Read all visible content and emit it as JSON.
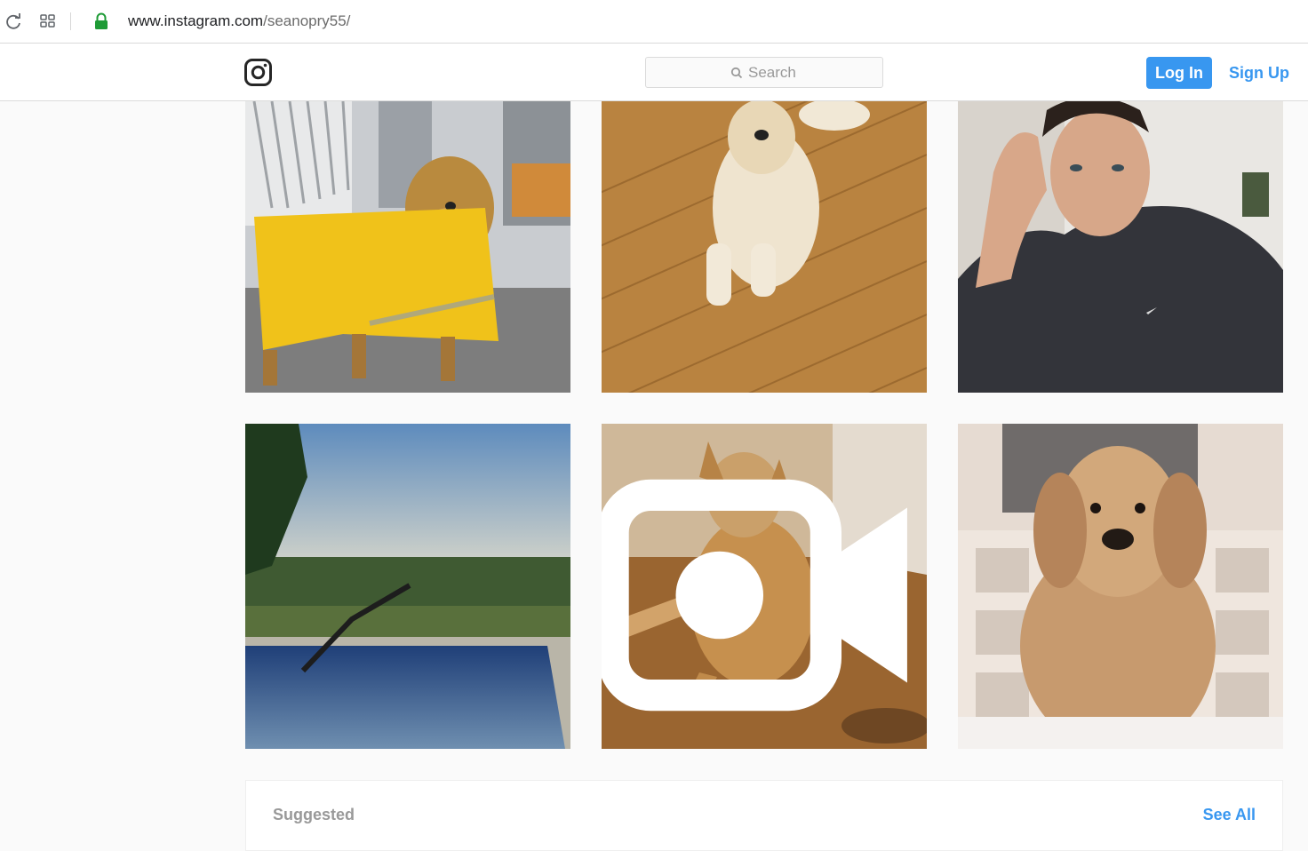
{
  "browser": {
    "url_host": "www.instagram.com",
    "url_path": "/seanopry55/"
  },
  "nav": {
    "search_placeholder": "Search",
    "login_label": "Log In",
    "signup_label": "Sign Up"
  },
  "photos": [
    {
      "subject": "golden retriever in yellow raincoat"
    },
    {
      "subject": "golden retriever on wood floor"
    },
    {
      "subject": "man in black hoodie selfie"
    },
    {
      "subject": "person diving into infinity pool"
    },
    {
      "subject": "golden retriever dancing",
      "is_video": true
    },
    {
      "subject": "golden retriever portrait"
    }
  ],
  "suggested": {
    "title": "Suggested",
    "see_all": "See All"
  },
  "colors": {
    "accent": "#3897f0",
    "lock_green": "#1e9b36"
  }
}
